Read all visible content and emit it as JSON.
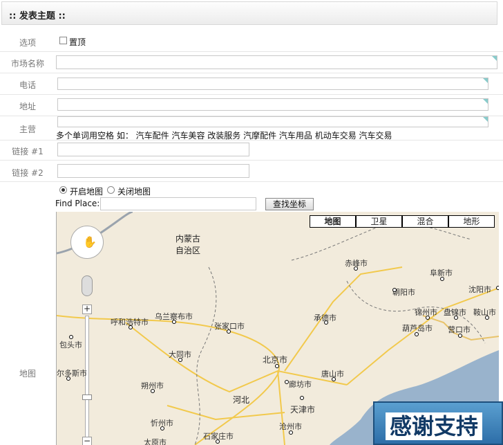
{
  "header": {
    "title": ":: 发表主题 ::"
  },
  "form": {
    "options": {
      "label": "选项",
      "checkbox_label": "置顶"
    },
    "market_name": {
      "label": "市场名称"
    },
    "phone": {
      "label": "电话"
    },
    "address": {
      "label": "地址"
    },
    "main_business": {
      "label": "主营",
      "hint": "多个单词用空格 如： 汽车配件 汽车美容 改装服务 汽摩配件 汽车用品 机动车交易 汽车交易"
    },
    "link1": {
      "label": "链接 #1"
    },
    "link2": {
      "label": "链接 #2"
    },
    "map": {
      "label": "地图",
      "radio_on": "开启地图",
      "radio_off": "关闭地图",
      "find_label": "Find Place:",
      "find_button": "查找坐标",
      "types": [
        "地图",
        "卫星",
        "混合",
        "地形"
      ],
      "regions": [
        "内蒙古自治区",
        "河北"
      ],
      "cities": [
        "赤峰市",
        "阜新市",
        "朝阳市",
        "沈阳市",
        "锦州市",
        "盘锦市",
        "鞍山市",
        "葫芦岛市",
        "营口市",
        "呼和浩特市",
        "乌兰察布市",
        "张家口市",
        "承德市",
        "包头市",
        "大同市",
        "北京市",
        "唐山市",
        "廊坊市",
        "朔州市",
        "天津市",
        "沧州市",
        "忻州市",
        "石家庄市",
        "太原市",
        "尔多斯市"
      ]
    }
  },
  "banner": {
    "text": "感谢支持"
  }
}
